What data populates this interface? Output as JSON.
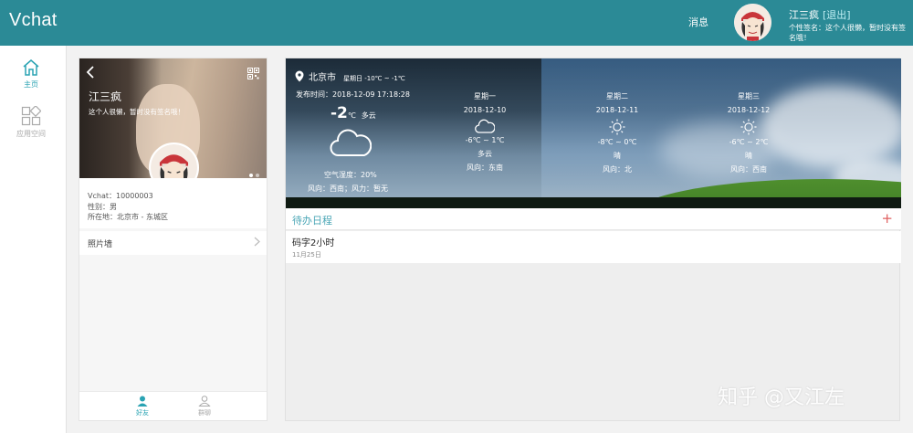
{
  "header": {
    "brand": "Vchat",
    "messages_label": "消息",
    "username": "江三疯",
    "logout_label": "[退出]",
    "signature": "个性签名：这个人很懒，暂时没有签名哦！"
  },
  "nav": {
    "items": [
      {
        "label": "主页",
        "icon": "home-icon",
        "active": true
      },
      {
        "label": "应用空间",
        "icon": "apps-icon",
        "active": false
      }
    ]
  },
  "profile": {
    "name": "江三疯",
    "signature": "这个人很懒，暂时没有签名哦！",
    "vchat": "Vchat：10000003",
    "gender": "性别：男",
    "location": "所在地：北京市 - 东城区",
    "photo_wall_label": "照片墙",
    "tabs": [
      {
        "label": "好友",
        "icon": "person-icon",
        "active": true
      },
      {
        "label": "群聊",
        "icon": "group-icon",
        "active": false
      }
    ]
  },
  "weather": {
    "city": "北京市",
    "today_summary": "星期日  -10℃ ~ -1℃",
    "publish_time": "发布时间：2018-12-09 17:18:28",
    "current_temp": "-2",
    "temp_unit": "℃",
    "current_condition": "多云",
    "humidity": "空气湿度：20%",
    "wind": "风向：西南；风力：暂无",
    "forecast": [
      {
        "weekday": "星期一",
        "date": "2018-12-10",
        "icon": "cloud-icon",
        "range": "-6℃ ~ 1℃",
        "condition": "多云",
        "wind": "风向：东南"
      },
      {
        "weekday": "星期二",
        "date": "2018-12-11",
        "icon": "sun-icon",
        "range": "-8℃ ~ 0℃",
        "condition": "晴",
        "wind": "风向：北"
      },
      {
        "weekday": "星期三",
        "date": "2018-12-12",
        "icon": "sun-icon",
        "range": "-6℃ ~ 2℃",
        "condition": "晴",
        "wind": "风向：西南"
      }
    ]
  },
  "todo": {
    "title": "待办日程",
    "add_label": "+",
    "items": [
      {
        "text": "码字2小时",
        "date": "11月25日"
      }
    ]
  },
  "watermark": "知乎 @又江左",
  "colors": {
    "topbar": "#2b8a96",
    "accent": "#2aa3b3",
    "add_button": "#e06060"
  }
}
